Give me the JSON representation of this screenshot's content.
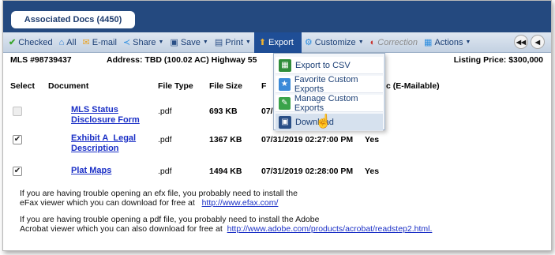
{
  "window": {
    "tab_label": "Associated Docs (4450)"
  },
  "toolbar": {
    "checked": "Checked",
    "all": "All",
    "email": "E-mail",
    "share": "Share",
    "save": "Save",
    "print": "Print",
    "export": "Export",
    "customize": "Customize",
    "correction": "Correction",
    "actions": "Actions",
    "nav_first": "◀◀",
    "nav_prev": "◀"
  },
  "listing": {
    "mls": "MLS #98739437",
    "address": "Address: TBD (100.02 AC) Highway 55",
    "price": "Listing Price: $300,000"
  },
  "columns": {
    "select": "Select",
    "document": "Document",
    "file_type": "File Type",
    "file_size": "File Size",
    "date_partial": "F",
    "emailable": "c (E-Mailable)"
  },
  "rows": [
    {
      "name": "MLS Status Disclosure Form",
      "type": ".pdf",
      "size": "693 KB",
      "date": "07/",
      "emailable": "",
      "checked": false,
      "disabled": true
    },
    {
      "name": "Exhibit A_Legal Description",
      "type": ".pdf",
      "size": "1367 KB",
      "date": "07/31/2019 02:27:00 PM",
      "emailable": "Yes",
      "checked": true,
      "disabled": false
    },
    {
      "name": "Plat Maps",
      "type": ".pdf",
      "size": "1494 KB",
      "date": "07/31/2019 02:28:00 PM",
      "emailable": "Yes",
      "checked": true,
      "disabled": false
    }
  ],
  "notes": {
    "efx_line1": "If you are having trouble opening an efx file, you probably need to install the",
    "efx_line2": "eFax viewer which you can download for free at",
    "efx_link": "http://www.efax.com/",
    "pdf_line1": "If you are having trouble opening a pdf file, you probably need to install the Adobe",
    "pdf_line2": "Acrobat viewer which you can also download for free at",
    "pdf_link": "http://www.adobe.com/products/acrobat/readstep2.html."
  },
  "export_menu": [
    {
      "label": "Export to CSV",
      "icon": "csv-icon"
    },
    {
      "label": "Favorite Custom Exports",
      "icon": "favorite-export-icon"
    },
    {
      "label": "Manage Custom Exports",
      "icon": "manage-export-icon"
    },
    {
      "label": "Download",
      "icon": "download-icon"
    }
  ],
  "colors": {
    "header": "#24497f",
    "link": "#1a2fc6",
    "toolbar_text": "#1b3f75",
    "export_active": "#1f4e96"
  }
}
